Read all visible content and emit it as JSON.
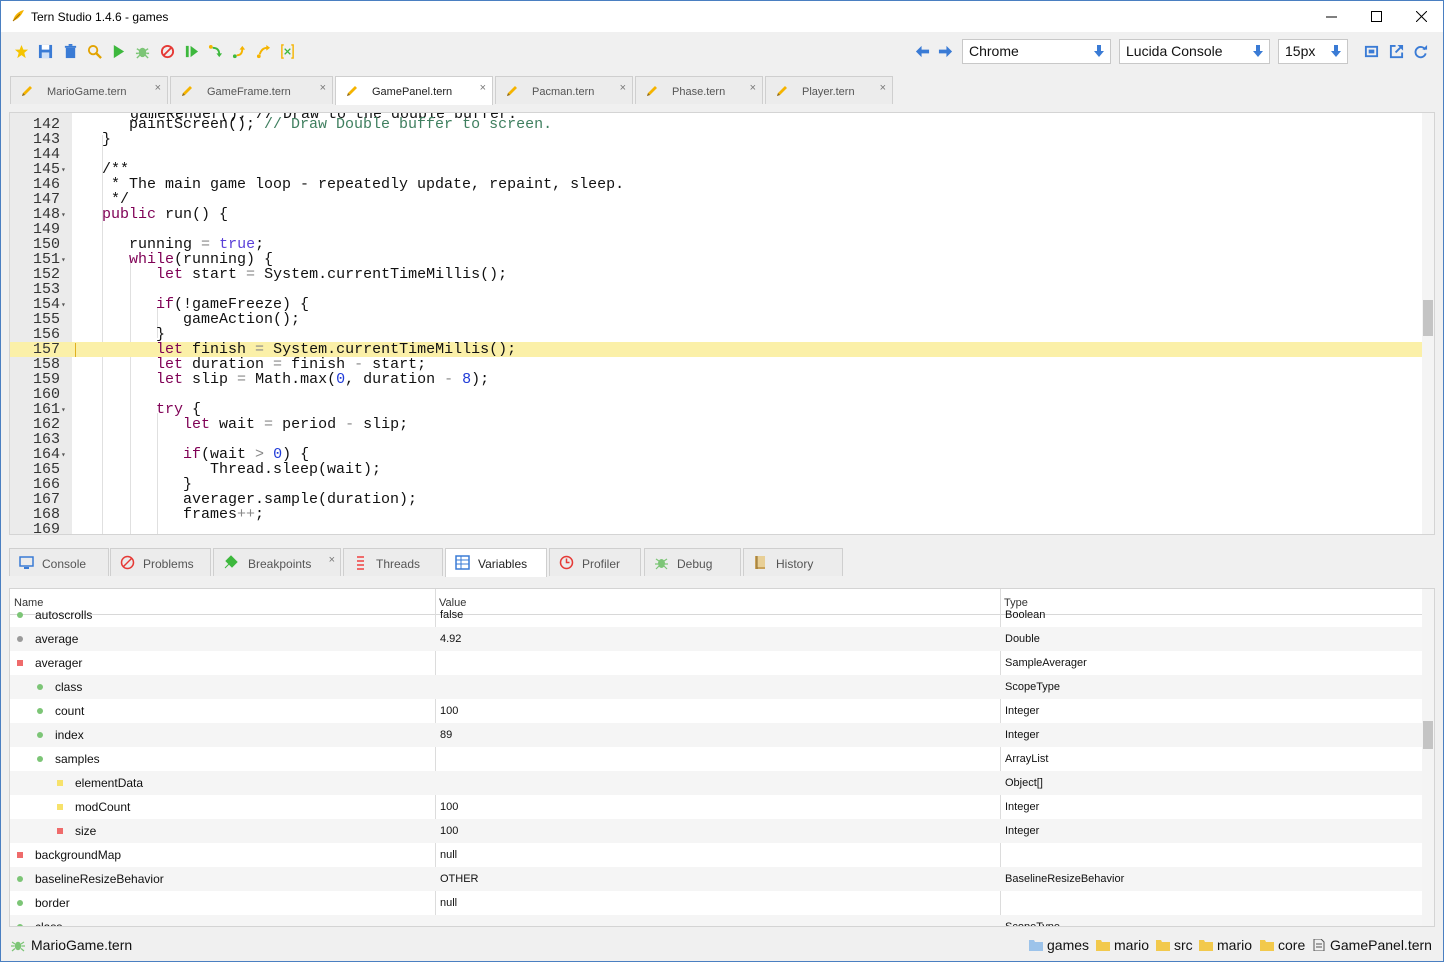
{
  "window": {
    "title": "Tern Studio 1.4.6 - games"
  },
  "toolbar": {
    "browser": "Chrome",
    "font": "Lucida Console",
    "font_size": "15px"
  },
  "editor_tabs": [
    {
      "label": "MarioGame.tern",
      "active": false
    },
    {
      "label": "GameFrame.tern",
      "active": false
    },
    {
      "label": "GamePanel.tern",
      "active": true
    },
    {
      "label": "Pacman.tern",
      "active": false
    },
    {
      "label": "Phase.tern",
      "active": false
    },
    {
      "label": "Player.tern",
      "active": false
    }
  ],
  "editor": {
    "line_numbers": [
      "142",
      "143",
      "144",
      "145",
      "146",
      "147",
      "148",
      "149",
      "150",
      "151",
      "152",
      "153",
      "154",
      "155",
      "156",
      "157",
      "158",
      "159",
      "160",
      "161",
      "162",
      "163",
      "164",
      "165",
      "166",
      "167",
      "168",
      "169"
    ],
    "highlighted_line": "157",
    "partial_top_line": "gameRender(); // Draw to the double buffer."
  },
  "bottom_tabs": [
    {
      "label": "Console",
      "active": false
    },
    {
      "label": "Problems",
      "active": false
    },
    {
      "label": "Breakpoints",
      "active": false
    },
    {
      "label": "Threads",
      "active": false
    },
    {
      "label": "Variables",
      "active": true
    },
    {
      "label": "Profiler",
      "active": false
    },
    {
      "label": "Debug",
      "active": false
    },
    {
      "label": "History",
      "active": false
    }
  ],
  "variables": {
    "columns": [
      "Name",
      "Value",
      "Type"
    ],
    "rows": [
      {
        "name": "autoscrolls",
        "value": "false",
        "type": "Boolean",
        "marker": "dot-green"
      },
      {
        "name": "average",
        "value": "4.92",
        "type": "Double",
        "marker": "dot-grey"
      },
      {
        "name": "averager",
        "value": "",
        "type": "SampleAverager",
        "marker": "square-red"
      },
      {
        "name": "class",
        "value": "",
        "type": "ScopeType",
        "marker": "dot-green"
      },
      {
        "name": "count",
        "value": "100",
        "type": "Integer",
        "marker": "dot-green"
      },
      {
        "name": "index",
        "value": "89",
        "type": "Integer",
        "marker": "dot-green"
      },
      {
        "name": "samples",
        "value": "",
        "type": "ArrayList",
        "marker": "dot-green"
      },
      {
        "name": "elementData",
        "value": "",
        "type": "Object[]",
        "marker": "square-yellow"
      },
      {
        "name": "modCount",
        "value": "100",
        "type": "Integer",
        "marker": "square-yellow"
      },
      {
        "name": "size",
        "value": "100",
        "type": "Integer",
        "marker": "square-red"
      },
      {
        "name": "backgroundMap",
        "value": "null",
        "type": "",
        "marker": "square-red"
      },
      {
        "name": "baselineResizeBehavior",
        "value": "OTHER",
        "type": "BaselineResizeBehavior",
        "marker": "dot-green"
      },
      {
        "name": "border",
        "value": "null",
        "type": "",
        "marker": "dot-green"
      },
      {
        "name": "class",
        "value": "",
        "type": "ScopeType",
        "marker": "dot-green"
      }
    ]
  },
  "status": {
    "file": "MarioGame.tern",
    "breadcrumb": [
      "games",
      "mario",
      "src",
      "mario",
      "core",
      "GamePanel.tern"
    ]
  },
  "colors": {
    "accent_frame": "#4a7fc1",
    "highlight_line": "#fbf0a8",
    "keyword": "#7f0055",
    "comment": "#3f7f5f",
    "number": "#1f3ad8",
    "marker_green": "#7cc576",
    "marker_grey": "#9a9a9a",
    "marker_red": "#ef6b6b",
    "marker_yellow": "#f7e26b"
  },
  "icons": {
    "app": "tern-leaf-icon",
    "toolbar": [
      "star-icon",
      "save-icon",
      "delete-icon",
      "search-icon",
      "run-icon",
      "debug-bug-icon",
      "stop-icon",
      "resume-icon",
      "step-over-icon",
      "step-into-icon",
      "step-out-icon",
      "evaluate-icon",
      "back-arrow-icon",
      "forward-arrow-icon",
      "maximize-editor-icon",
      "external-icon",
      "refresh-icon"
    ]
  }
}
